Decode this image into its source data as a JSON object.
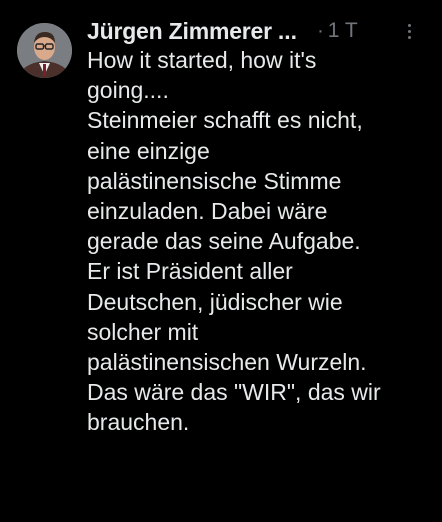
{
  "post": {
    "author_name": "Jürgen Zimmerer",
    "author_ellipsis": "...",
    "separator": "·",
    "timestamp": "1 T",
    "lines": [
      "How it started, how it's",
      "going....",
      "Steinmeier schafft es nicht,",
      "eine einzige",
      "palästinensische Stimme",
      "einzuladen. Dabei wäre",
      "gerade das seine Aufgabe.",
      "Er ist Präsident aller",
      "Deutschen, jüdischer wie",
      "solcher mit",
      "palästinensischen Wurzeln.",
      "Das wäre das \"WIR\", das wir",
      "brauchen."
    ]
  },
  "colors": {
    "background": "#000000",
    "text_primary": "#e7e9ea",
    "text_secondary": "#71767b"
  }
}
